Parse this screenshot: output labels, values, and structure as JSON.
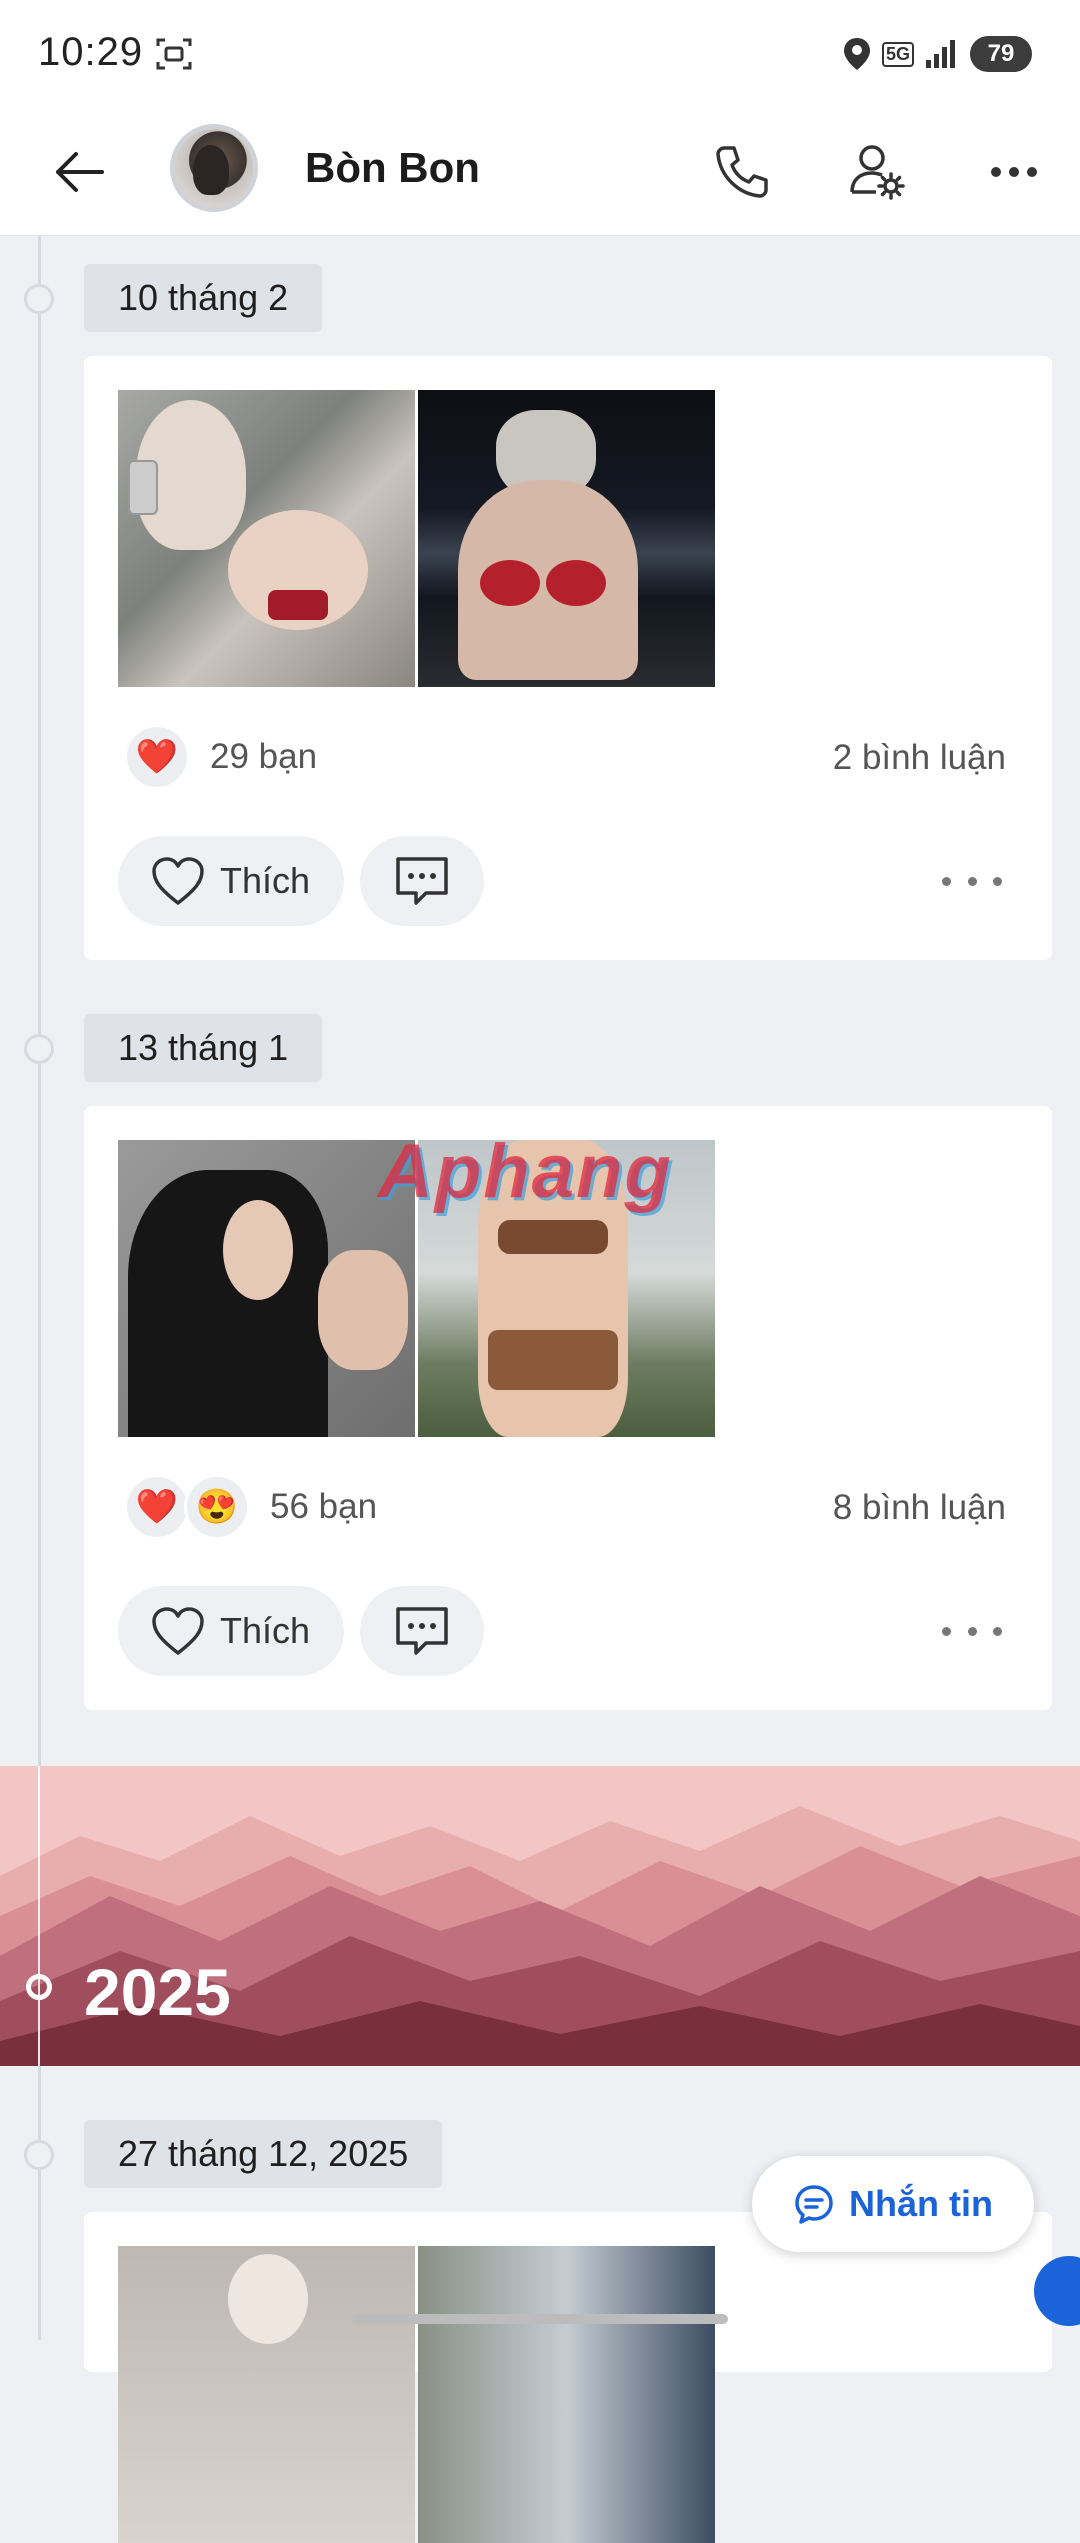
{
  "status": {
    "time": "10:29",
    "network": "5G",
    "battery": "79"
  },
  "header": {
    "contact_name": "Bòn Bon"
  },
  "posts": [
    {
      "date": "10 tháng 2",
      "reaction_count": "29 bạn",
      "comment_count": "2 bình luận",
      "like_label": "Thích"
    },
    {
      "date": "13 tháng 1",
      "reaction_count": "56 bạn",
      "comment_count": "8 bình luận",
      "like_label": "Thích"
    },
    {
      "date": "27 tháng 12, 2025"
    }
  ],
  "year_banner": {
    "year": "2025"
  },
  "watermark": "Aphang",
  "message_button": {
    "label": "Nhắn tin"
  },
  "colors": {
    "accent": "#1a63d8",
    "banner_top": "#f0c1c0",
    "banner_bottom": "#7a2f3c"
  }
}
